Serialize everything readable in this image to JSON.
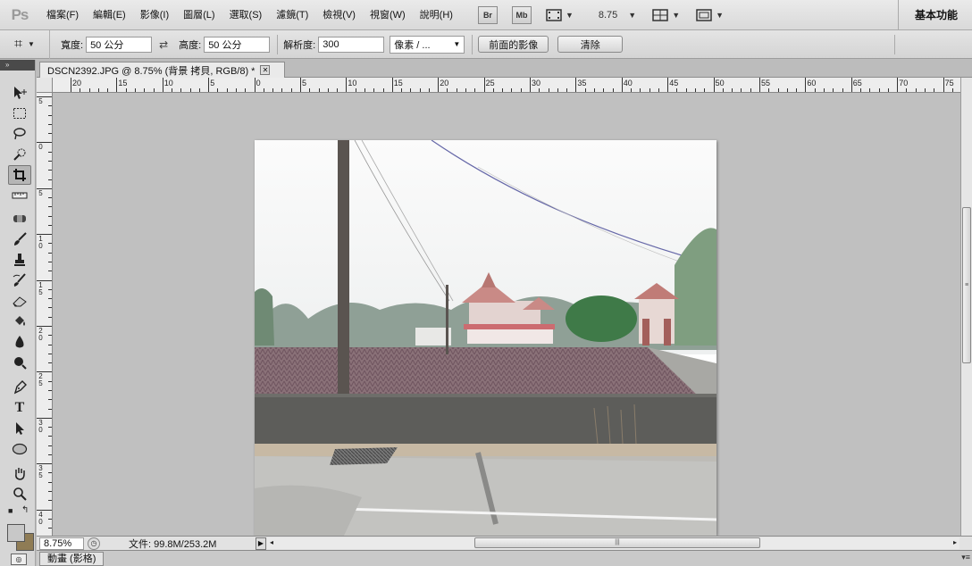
{
  "app": {
    "logo": "Ps",
    "workspace": "基本功能"
  },
  "menu": [
    "檔案(F)",
    "編輯(E)",
    "影像(I)",
    "圖層(L)",
    "選取(S)",
    "濾鏡(T)",
    "檢視(V)",
    "視窗(W)",
    "說明(H)"
  ],
  "appbar": {
    "bridge": "Br",
    "mini_bridge": "Mb",
    "zoom": "8.75"
  },
  "options": {
    "width_label": "寬度:",
    "width_value": "50 公分",
    "height_label": "高度:",
    "height_value": "50 公分",
    "resolution_label": "解析度:",
    "resolution_value": "300",
    "unit_select": "像素 / ...",
    "front_image_button": "前面的影像",
    "clear_button": "清除"
  },
  "document": {
    "tab_title": "DSCN2392.JPG @ 8.75% (背景 拷貝, RGB/8) *",
    "close": "✕"
  },
  "rulers": {
    "horizontal": [
      "20",
      "15",
      "10",
      "5",
      "0",
      "5",
      "10",
      "15",
      "20",
      "25",
      "30",
      "35",
      "40",
      "45",
      "50",
      "55",
      "60",
      "65",
      "70",
      "75"
    ],
    "vertical": [
      "5",
      "0",
      "5",
      "1 0",
      "1 5",
      "2 0",
      "2 5",
      "3 0",
      "3 5",
      "4 0"
    ]
  },
  "status": {
    "zoom": "8.75%",
    "doc_info": "文件: 99.8M/253.2M"
  },
  "bottom_panel": {
    "tab": "動畫 (影格)"
  },
  "colors": {
    "accent": "#5a6ab0",
    "foreground": "#c8c8c8",
    "background": "#8f7c55"
  },
  "tools": [
    "move-icon",
    "marquee-icon",
    "lasso-icon",
    "quick-select-icon",
    "crop-icon",
    "ruler-icon",
    "spot-heal-icon",
    "brush-icon",
    "stamp-icon",
    "history-brush-icon",
    "eraser-icon",
    "bucket-icon",
    "blur-icon",
    "dodge-icon",
    "pen-icon",
    "type-icon",
    "path-select-icon",
    "ellipse-icon",
    "hand-icon",
    "zoom-icon"
  ]
}
